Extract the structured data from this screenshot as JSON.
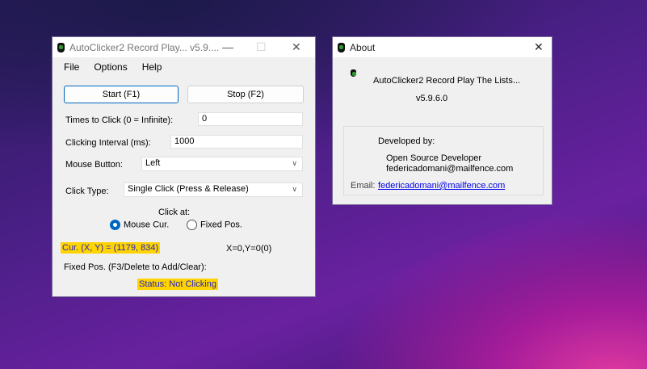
{
  "main": {
    "title": "AutoClicker2 Record Play... v5.9....",
    "menu": [
      "File",
      "Options",
      "Help"
    ],
    "start": "Start (F1)",
    "stop": "Stop (F2)",
    "times_label": "Times to Click (0 = Infinite):",
    "times_value": "0",
    "interval_label": "Clicking Interval (ms):",
    "interval_value": "1000",
    "mouse_label": "Mouse Button:",
    "mouse_value": "Left",
    "type_label": "Click Type:",
    "type_value": "Single Click (Press & Release)",
    "click_at": "Click at:",
    "radio_mouse": "Mouse Cur.",
    "radio_fixed": "Fixed Pos.",
    "selected": "Mouse Cur.",
    "cur": "Cur. (X, Y) = (1179, 834)",
    "xy": "X=0,Y=0(0)",
    "fixed_label": "Fixed Pos. (F3/Delete to Add/Clear):",
    "status": "Status:  Not Clicking"
  },
  "about": {
    "title": "About",
    "app": "AutoClicker2 Record Play The Lists...",
    "version": "v5.9.6.0",
    "developed": "Developed by:",
    "dev_name": "Open Source Developer",
    "dev_email": "federicadomani@mailfence.com",
    "email_label": "Email:",
    "email_link": "federicadomani@mailfence.com"
  },
  "colors": {
    "highlight": "#ffd400",
    "accent": "#0067c0",
    "link": "#0000ee"
  }
}
